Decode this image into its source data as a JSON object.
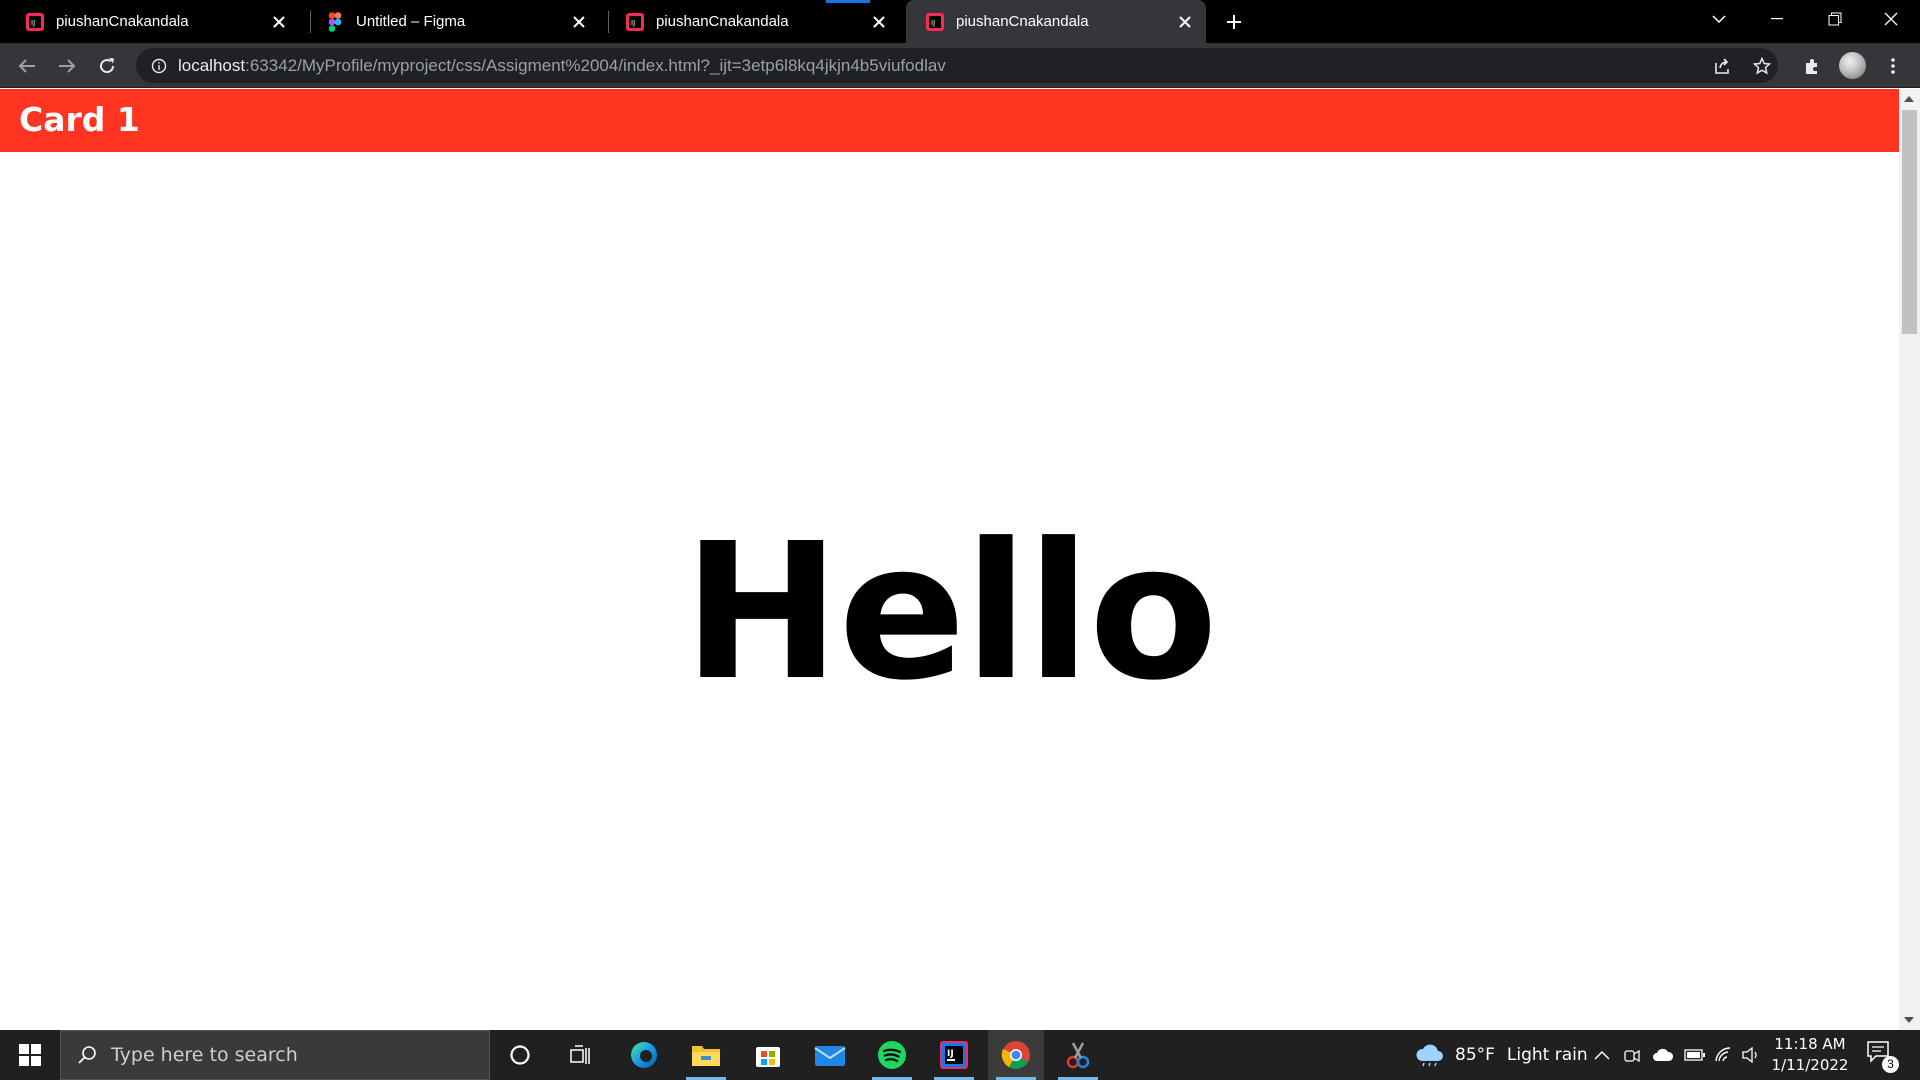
{
  "browser": {
    "tabs": [
      {
        "title": "piushanCnakandala",
        "icon": "intellij-icon"
      },
      {
        "title": "Untitled – Figma",
        "icon": "figma-icon"
      },
      {
        "title": "piushanCnakandala",
        "icon": "intellij-icon"
      },
      {
        "title": "piushanCnakandala",
        "icon": "intellij-icon",
        "active": true
      }
    ],
    "url_host": "localhost",
    "url_rest": ":63342/MyProfile/myproject/css/Assigment%2004/index.html?_ijt=3etp6l8kq4jkjn4b5viufodlav"
  },
  "page": {
    "card_title": "Card 1",
    "hello_text": "Hello",
    "header_color": "#ff3521"
  },
  "taskbar": {
    "search_placeholder": "Type here to search",
    "weather_temp": "85°F",
    "weather_desc": "Light rain",
    "time": "11:18 AM",
    "date": "1/11/2022",
    "notification_count": "3",
    "apps": [
      "cortana-icon",
      "task-view-icon",
      "edge-icon",
      "file-explorer-icon",
      "store-icon",
      "mail-icon",
      "spotify-icon",
      "intellij-icon",
      "chrome-icon",
      "snip-icon"
    ]
  }
}
